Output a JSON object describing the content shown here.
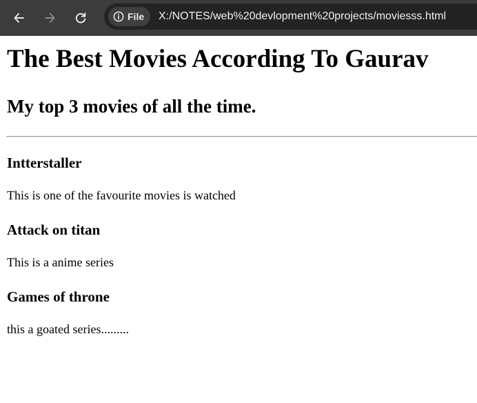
{
  "browser": {
    "site_chip_label": "File",
    "url": "X:/NOTES/web%20devlopment%20projects/moviesss.html"
  },
  "page": {
    "title": "The Best Movies According To Gaurav",
    "subtitle": "My top 3 movies of all the time.",
    "movies": [
      {
        "title": "Intterstaller",
        "description": "This is one of the favourite movies is watched"
      },
      {
        "title": "Attack on titan",
        "description": "This is a anime series"
      },
      {
        "title": "Games of throne",
        "description": "this a goated series........."
      }
    ]
  }
}
